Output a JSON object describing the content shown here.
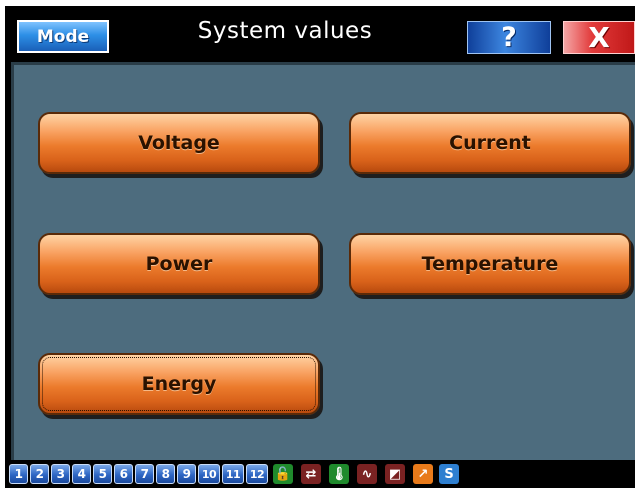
{
  "header": {
    "mode_label": "Mode",
    "title": "System values",
    "help_label": "?",
    "close_label": "X"
  },
  "menu": {
    "voltage": "Voltage",
    "current": "Current",
    "power": "Power",
    "temperature": "Temperature",
    "energy": "Energy"
  },
  "pages": [
    "1",
    "2",
    "3",
    "4",
    "5",
    "6",
    "7",
    "8",
    "9",
    "10",
    "11",
    "12"
  ],
  "status_icons": [
    {
      "name": "unlock-icon",
      "glyph": "🔓",
      "color": "#1f8a2c"
    },
    {
      "name": "arrows-icon",
      "glyph": "⇄",
      "color": "#7a2222"
    },
    {
      "name": "thermometer-icon",
      "glyph": "🌡",
      "color": "#1f8a2c"
    },
    {
      "name": "graph-icon",
      "glyph": "∿",
      "color": "#7a2222"
    },
    {
      "name": "chart-icon",
      "glyph": "◩",
      "color": "#7a2222"
    },
    {
      "name": "arrow-up-right-icon",
      "glyph": "↗",
      "color": "#e87a1a"
    },
    {
      "name": "s-icon",
      "glyph": "S",
      "color": "#2e7fd0"
    }
  ],
  "colors": {
    "panel_bg": "#4d6c7e",
    "button_orange": "#ec7b2c",
    "mode_blue": "#2d8fe6",
    "close_red": "#e23a3a"
  }
}
